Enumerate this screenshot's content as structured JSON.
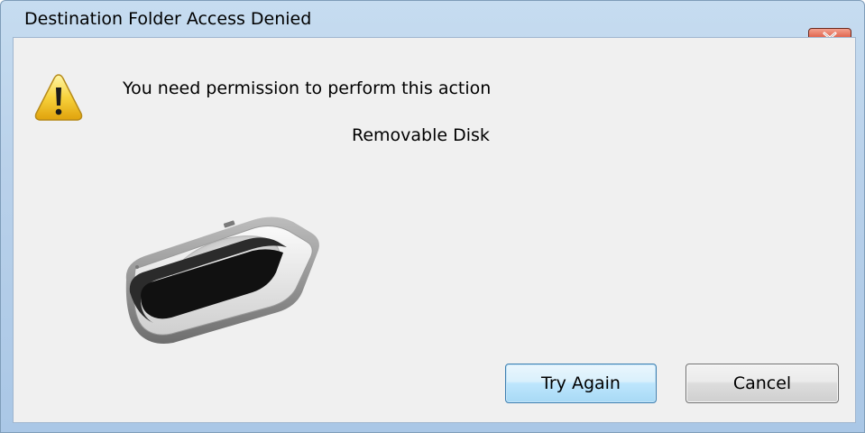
{
  "window": {
    "title": "Destination Folder Access Denied"
  },
  "dialog": {
    "message": "You need permission to perform this action",
    "item_name": "Removable Disk",
    "icons": {
      "warning": "warning-icon",
      "disk": "removable-disk-icon",
      "close": "close-icon"
    }
  },
  "buttons": {
    "try_again": "Try Again",
    "cancel": "Cancel"
  },
  "colors": {
    "title_bar": "#b9d1ea",
    "close_button": "#c73d22",
    "client_bg": "#f0f0f0",
    "default_button_border": "#3c7fb1"
  }
}
